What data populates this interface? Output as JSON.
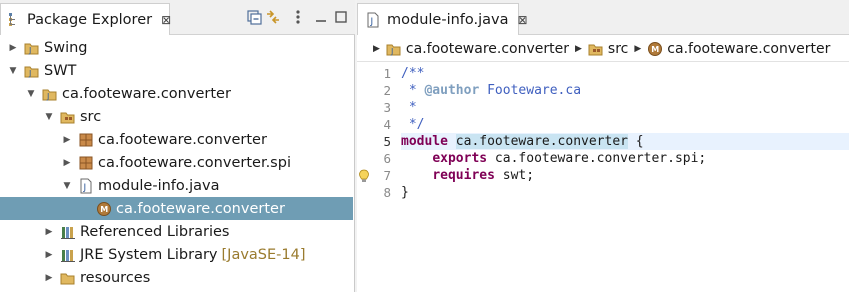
{
  "package_explorer": {
    "title": "Package Explorer",
    "close_glyph": "⊠",
    "toolbar_icons": [
      "collapse-all-icon",
      "link-with-editor-icon",
      "view-menu-icon",
      "minimize-icon",
      "maximize-icon"
    ],
    "tree": [
      {
        "label": "Swing",
        "state": "collapsed",
        "icon": "java-project-icon",
        "selected": false
      },
      {
        "label": "SWT",
        "state": "expanded",
        "icon": "java-project-icon",
        "selected": false
      },
      {
        "label": "ca.footeware.converter",
        "state": "expanded",
        "icon": "java-project-icon",
        "selected": false
      },
      {
        "label": "src",
        "state": "expanded",
        "icon": "source-folder-icon",
        "selected": false
      },
      {
        "label": "ca.footeware.converter",
        "state": "collapsed",
        "icon": "package-icon",
        "selected": false
      },
      {
        "label": "ca.footeware.converter.spi",
        "state": "collapsed",
        "icon": "package-icon",
        "selected": false
      },
      {
        "label": "module-info.java",
        "state": "expanded",
        "icon": "java-file-icon",
        "selected": false
      },
      {
        "label": "ca.footeware.converter",
        "state": "leaf",
        "icon": "module-icon",
        "selected": true
      },
      {
        "label": "Referenced Libraries",
        "state": "collapsed",
        "icon": "library-icon",
        "selected": false
      },
      {
        "label": "JRE System Library",
        "decoration": "[JavaSE-14]",
        "state": "collapsed",
        "icon": "library-icon",
        "selected": false
      },
      {
        "label": "resources",
        "state": "collapsed",
        "icon": "folder-icon",
        "selected": false
      }
    ]
  },
  "editor": {
    "tab_title": "module-info.java",
    "close_glyph": "⊠",
    "breadcrumb": [
      {
        "label": "ca.footeware.converter",
        "icon": "java-project-icon"
      },
      {
        "label": "src",
        "icon": "source-folder-icon"
      },
      {
        "label": "ca.footeware.converter",
        "icon": "module-icon"
      }
    ],
    "line_numbers": [
      "1",
      "2",
      "3",
      "4",
      "5",
      "6",
      "7",
      "8"
    ],
    "code": {
      "l1": "/**",
      "l2_pre": " * ",
      "l2_tag": "@author",
      "l2_post": " Footeware.ca",
      "l3": " *",
      "l4": " */",
      "l5_kw": "module",
      "l5_sp": " ",
      "l5_name": "ca.footeware.converter",
      "l5_post": " {",
      "l6_ind": "    ",
      "l6_kw": "exports",
      "l6_post": " ca.footeware.converter.spi;",
      "l7_ind": "    ",
      "l7_kw": "requires",
      "l7_post": " swt;",
      "l8": "}"
    },
    "current_line": 5,
    "warning_line": 7
  },
  "colors": {
    "selection": "#6f9db4",
    "keyword": "#7f0055",
    "comment": "#3f5fbf",
    "javadoc_tag": "#7f9fbf",
    "occurrence_highlight": "#c9e4f2",
    "current_line": "#e8f2fe"
  }
}
